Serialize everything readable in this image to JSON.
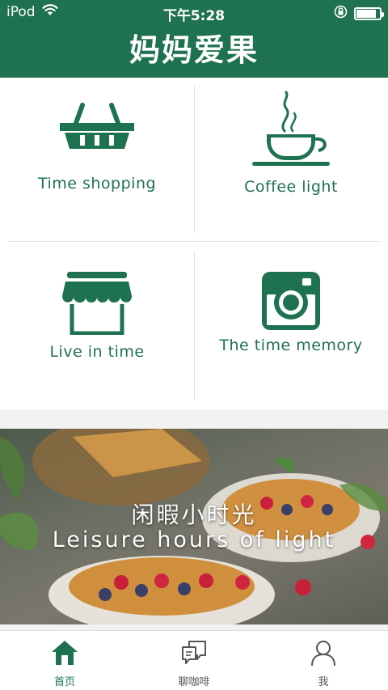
{
  "status_bar": {
    "carrier": "iPod",
    "time": "下午5:28",
    "battery_level": 0.85
  },
  "header": {
    "title": "妈妈爱果"
  },
  "features": [
    {
      "label": "Time shopping",
      "icon": "basket-icon"
    },
    {
      "label": "Coffee light",
      "icon": "coffee-cup-icon"
    },
    {
      "label": "Live in time",
      "icon": "storefront-icon"
    },
    {
      "label": "The time memory",
      "icon": "camera-icon"
    }
  ],
  "banner": {
    "title": "闲暇小时光",
    "subtitle": "Leisure hours of light"
  },
  "tabbar": {
    "items": [
      {
        "label": "首页",
        "icon": "home-icon",
        "active": true
      },
      {
        "label": "聊咖啡",
        "icon": "chat-bubbles-icon",
        "active": false
      },
      {
        "label": "我",
        "icon": "person-icon",
        "active": false
      }
    ]
  },
  "colors": {
    "brand_green": "#1e7250",
    "background": "#f2f2f2"
  }
}
